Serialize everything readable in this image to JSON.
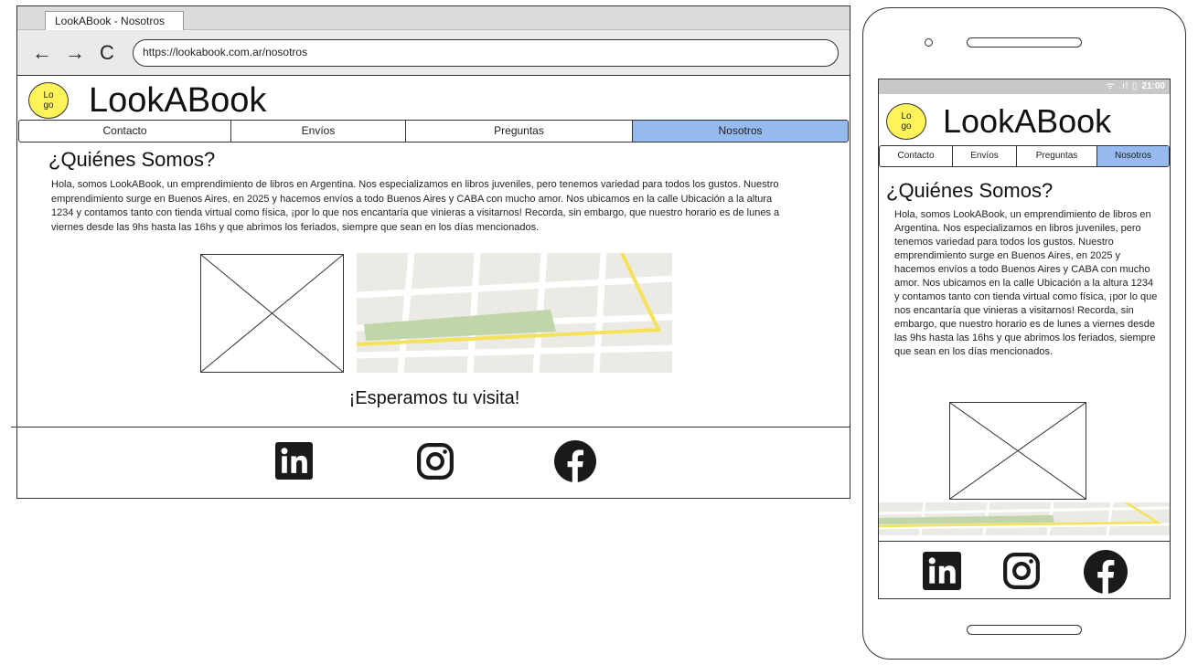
{
  "browser": {
    "tab_title": "LookABook - Nosotros",
    "url": "https://lookabook.com.ar/nosotros",
    "back_icon": "←",
    "forward_icon": "→",
    "reload_icon": "C"
  },
  "site": {
    "logo_text_1": "Lo",
    "logo_text_2": "go",
    "brand": "LookABook",
    "menu": [
      "Contacto",
      "Envíos",
      "Preguntas",
      "Nosotros"
    ],
    "active_menu": "Nosotros",
    "heading": "¿Quiénes Somos?",
    "body": "Hola, somos LookABook, un emprendimiento de libros en Argentina. Nos especializamos en libros juveniles, pero tenemos variedad para todos los gustos. Nuestro emprendimiento surge en Buenos Aires, en 2025 y hacemos envíos a todo Buenos Aires y CABA con mucho amor. Nos ubicamos en la calle Ubicación a la altura 1234 y contamos tanto con tienda virtual como física, ¡por lo que nos encantaría que vinieras a visitarnos! Recorda, sin embargo, que nuestro horario es de lunes a viernes desde las 9hs hasta las 16hs y que abrimos los feriados, siempre que sean en los días mencionados.",
    "visit": "¡Esperamos tu visita!",
    "social": [
      "linkedin-icon",
      "instagram-icon",
      "facebook-icon"
    ]
  },
  "phone": {
    "status_time": "21:00",
    "status_icons": "ᯤ .ıl ▯"
  },
  "colors": {
    "logo_yellow": "#fff35a",
    "active_tab_blue": "#96b9ee",
    "map_park_green": "#c1d6a8",
    "map_road_yellow": "#f4e25a"
  }
}
